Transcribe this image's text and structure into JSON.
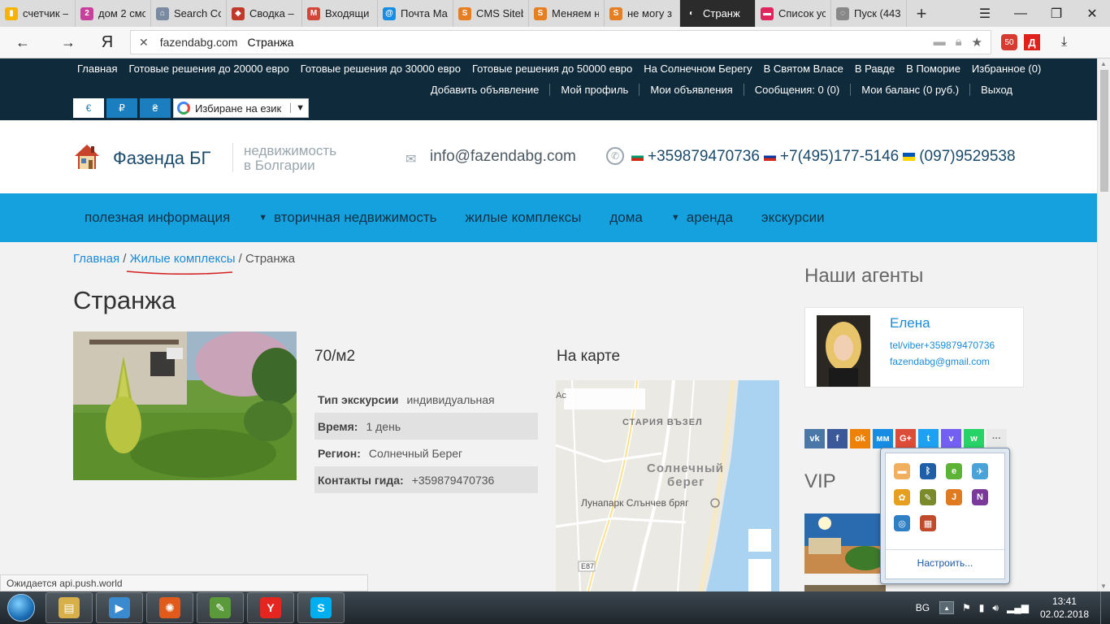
{
  "browser": {
    "tabs": [
      {
        "label": "счетчик –",
        "fav_color": "#f5b400",
        "fav_glyph": "▮"
      },
      {
        "label": "дом 2 смс",
        "fav_color": "#c7409b",
        "fav_glyph": "2"
      },
      {
        "label": "Search Co",
        "fav_color": "#7a8aa0",
        "fav_glyph": "⌂"
      },
      {
        "label": "Сводка –",
        "fav_color": "#c0392b",
        "fav_glyph": "◆"
      },
      {
        "label": "Входящи",
        "fav_color": "#d44638",
        "fav_glyph": "M"
      },
      {
        "label": "Почта Ма",
        "fav_color": "#168de2",
        "fav_glyph": "@"
      },
      {
        "label": "CMS Siteb",
        "fav_color": "#e67e22",
        "fav_glyph": "S"
      },
      {
        "label": "Меняем н",
        "fav_color": "#e67e22",
        "fav_glyph": "S"
      },
      {
        "label": "не могу з",
        "fav_color": "#e67e22",
        "fav_glyph": "S"
      },
      {
        "label": "Странж",
        "fav_color": "#2b2b2b",
        "fav_glyph": "◐",
        "active": true
      },
      {
        "label": "Список ус",
        "fav_color": "#e0245e",
        "fav_glyph": "▬"
      },
      {
        "label": "Пуск (443",
        "fav_color": "#888888",
        "fav_glyph": "◌"
      }
    ],
    "address": {
      "domain": "fazendabg.com",
      "title": "Странжа"
    },
    "ext_badge": "50",
    "ext_d": "Д"
  },
  "site": {
    "top_menu": [
      "Главная",
      "Готовые решения до 20000 евро",
      "Готовые решения до 30000 евро",
      "Готовые решения до 50000 евро",
      "На Солнечном Берегу",
      "В Святом Власе",
      "В Равде",
      "В Поморие",
      "Избранное (0)"
    ],
    "user_menu": [
      "Добавить объявление",
      "Мой профиль",
      "Мои объявления",
      "Сообщения: 0 (0)",
      "Мои баланс (0 руб.)",
      "Выход"
    ],
    "currencies": [
      "€",
      "₽",
      "₴"
    ],
    "language_select": "Избиране на език",
    "logo_name": "Фазенда БГ",
    "tagline_1": "недвижимость",
    "tagline_2": "в Болгарии",
    "email": "info@fazendabg.com",
    "phone_bg": "+359879470736",
    "phone_ru": "+7(495)177-5146",
    "phone_ua": "(097)9529538",
    "main_nav": [
      {
        "label": "полезная информация",
        "dropdown": false
      },
      {
        "label": "вторичная недвижимость",
        "dropdown": true
      },
      {
        "label": "жилые комплексы",
        "dropdown": false
      },
      {
        "label": "дома",
        "dropdown": false
      },
      {
        "label": "аренда",
        "dropdown": true
      },
      {
        "label": "экскурсии",
        "dropdown": false
      }
    ],
    "breadcrumb": {
      "home": "Главная",
      "sep": "/",
      "section": "Жилые комплексы",
      "current": "Странжа"
    },
    "page_title": "Странжа",
    "price": "70/м2",
    "properties": [
      {
        "key": "Тип экскурсии",
        "value": "индивидуальная"
      },
      {
        "key": "Время:",
        "value": "1 день"
      },
      {
        "key": "Регион:",
        "value": "Солнечный Берег"
      },
      {
        "key": "Контакты гида:",
        "value": "+359879470736"
      }
    ],
    "map_title": "На карте",
    "map_labels": {
      "a": "Ас",
      "old_node": "СТАРИЯ ВЪЗЕЛ",
      "sunny_1": "Солнечный",
      "sunny_2": "берег",
      "lunapark": "Лунапарк Слънчев бряг",
      "road": "E87"
    },
    "agents_title": "Наши агенты",
    "agent": {
      "name": "Елена",
      "tel": "tel/viber+359879470736",
      "mail": "fazendabg@gmail.com"
    },
    "social": [
      {
        "glyph": "vk",
        "color": "#4a76a8"
      },
      {
        "glyph": "f",
        "color": "#3b5998"
      },
      {
        "glyph": "ok",
        "color": "#ee8208"
      },
      {
        "glyph": "мм",
        "color": "#168de2"
      },
      {
        "glyph": "G+",
        "color": "#dd4b39"
      },
      {
        "glyph": "t",
        "color": "#1da1f2"
      },
      {
        "glyph": "v",
        "color": "#7360f2"
      },
      {
        "glyph": "w",
        "color": "#25d366"
      },
      {
        "glyph": "···",
        "color": "#e9e9e9"
      }
    ],
    "vip_title": "VIP"
  },
  "status_text": "Ожидается api.push.world",
  "tray_popup": {
    "customize": "Настроить...",
    "icons": [
      {
        "name": "tray-app-icon-1",
        "color": "#f0b060",
        "glyph": "▬"
      },
      {
        "name": "bluetooth-icon",
        "color": "#1f5fa8",
        "glyph": "ᛒ"
      },
      {
        "name": "evernote-icon",
        "color": "#5cb335",
        "glyph": "e"
      },
      {
        "name": "tray-app-icon-4",
        "color": "#4aa3d8",
        "glyph": "✈"
      },
      {
        "name": "tray-app-icon-5",
        "color": "#e5a020",
        "glyph": "✿"
      },
      {
        "name": "tray-app-icon-6",
        "color": "#7b8a2a",
        "glyph": "✎"
      },
      {
        "name": "java-icon",
        "color": "#e07a20",
        "glyph": "J"
      },
      {
        "name": "onenote-icon",
        "color": "#7b3a9a",
        "glyph": "N"
      },
      {
        "name": "tray-app-icon-9",
        "color": "#2f7fc4",
        "glyph": "◎"
      },
      {
        "name": "tray-app-icon-10",
        "color": "#c04a2a",
        "glyph": "▦"
      }
    ]
  },
  "taskbar": {
    "apps": [
      {
        "name": "explorer-icon",
        "color": "#d8b04a",
        "glyph": "▤"
      },
      {
        "name": "media-player-icon",
        "color": "#3a8ad0",
        "glyph": "▶"
      },
      {
        "name": "media-center-icon",
        "color": "#e05a1a",
        "glyph": "✺"
      },
      {
        "name": "notepad-chart-icon",
        "color": "#5b9a3a",
        "glyph": "✎"
      },
      {
        "name": "yandex-browser-icon",
        "color": "#e52620",
        "glyph": "Y"
      },
      {
        "name": "skype-icon",
        "color": "#00aff0",
        "glyph": "S"
      }
    ],
    "lang": "BG",
    "time": "13:41",
    "date": "02.02.2018"
  }
}
